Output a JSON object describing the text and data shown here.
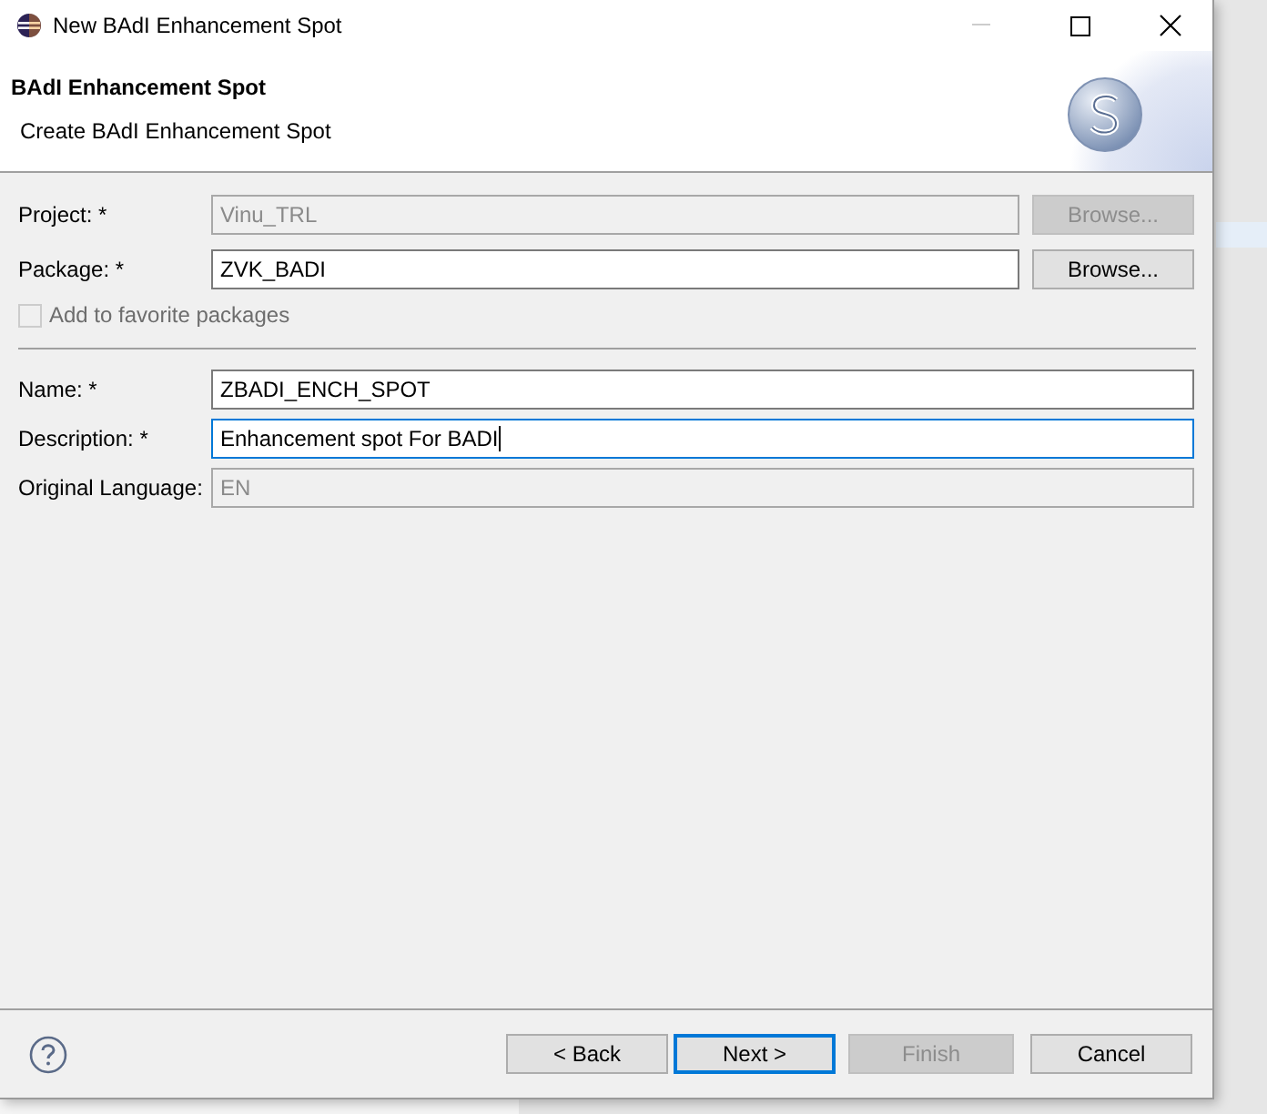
{
  "window": {
    "title": "New BAdI Enhancement Spot"
  },
  "header": {
    "title": "BAdI Enhancement Spot",
    "subtitle": "Create BAdI Enhancement Spot"
  },
  "fields": [
    {
      "label": "Project: *",
      "value": "Vinu_TRL",
      "disabled": true,
      "focused": false,
      "browse": {
        "label": "Browse...",
        "disabled": true
      }
    },
    {
      "label": "Package: *",
      "value": "ZVK_BADI",
      "disabled": false,
      "focused": false,
      "browse": {
        "label": "Browse...",
        "disabled": false
      }
    }
  ],
  "favorite": {
    "label": "Add to favorite packages",
    "checked": false,
    "disabled": true
  },
  "details": [
    {
      "label": "Name: *",
      "value": "ZBADI_ENCH_SPOT",
      "disabled": false,
      "focused": false
    },
    {
      "label": "Description: *",
      "value": "Enhancement spot For BADI",
      "disabled": false,
      "focused": true
    },
    {
      "label": "Original Language:",
      "value": "EN",
      "disabled": true,
      "focused": false
    }
  ],
  "buttons": [
    {
      "label": "< Back",
      "disabled": false,
      "default": false
    },
    {
      "label": "Next >",
      "disabled": false,
      "default": true
    },
    {
      "label": "Finish",
      "disabled": true,
      "default": false
    },
    {
      "label": "Cancel",
      "disabled": false,
      "default": false
    }
  ]
}
